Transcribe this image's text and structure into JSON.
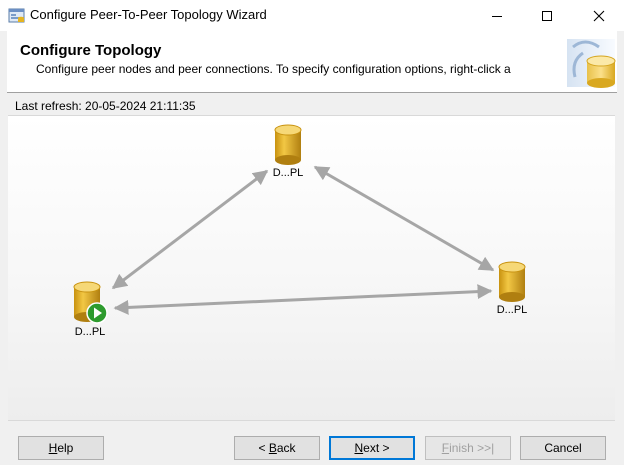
{
  "window": {
    "title": "Configure Peer-To-Peer Topology Wizard",
    "minimize_icon": "minimize-icon",
    "maximize_icon": "maximize-icon",
    "close_icon": "close-icon"
  },
  "header": {
    "title": "Configure Topology",
    "subtitle": "Configure peer nodes and peer connections. To specify configuration options, right-click a",
    "graphic_icon": "database-wizard-graphic"
  },
  "status": {
    "last_refresh": "Last refresh: 20-05-2024 21:11:35"
  },
  "topology": {
    "nodes": [
      {
        "id": "top",
        "label": "D...PL",
        "started": false
      },
      {
        "id": "left",
        "label": "D...PL",
        "started": true
      },
      {
        "id": "right",
        "label": "D...PL",
        "started": false
      }
    ],
    "connections": [
      {
        "from": "left",
        "to": "top"
      },
      {
        "from": "right",
        "to": "top"
      },
      {
        "from": "left",
        "to": "right"
      }
    ],
    "colors": {
      "cylinder": "#e5b422",
      "cylinder_dark": "#b07f10",
      "arrow": "#a6a6a6",
      "start_badge": "#2e9b2e"
    }
  },
  "buttons": {
    "help": {
      "pre": "",
      "key": "H",
      "post": "elp"
    },
    "back": {
      "pre": "< ",
      "key": "B",
      "post": "ack"
    },
    "next": {
      "pre": "",
      "key": "N",
      "post": "ext >"
    },
    "finish": {
      "pre": "",
      "key": "F",
      "post": "inish >>|"
    },
    "cancel": {
      "pre": "",
      "key": "",
      "post": "Cancel"
    }
  }
}
